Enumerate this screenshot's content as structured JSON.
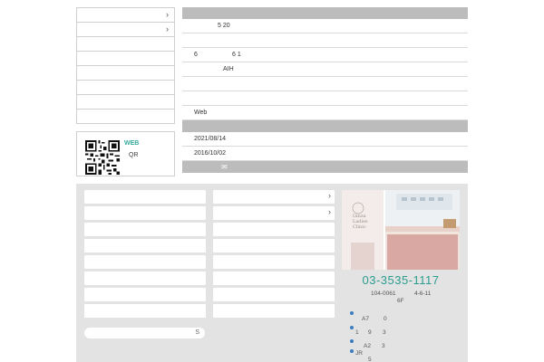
{
  "info_rows": [
    {
      "left": "",
      "right": "5 20"
    },
    {
      "left": "",
      "right": ""
    },
    {
      "left": "6",
      "right": "6 1"
    },
    {
      "left": "",
      "right": "AIH"
    },
    {
      "left": "",
      "right": ""
    },
    {
      "left": "Web",
      "right": ""
    }
  ],
  "news": [
    {
      "date": "2021/08/14"
    },
    {
      "date": "2016/10/02"
    }
  ],
  "qr": {
    "web_label": "WEB",
    "qr_label": "QR"
  },
  "clinic": {
    "logo_line1": "Ginza",
    "logo_line2": "Ladies",
    "logo_line3": "Clinic",
    "tel": "03-3535-1117",
    "postal": "104-0061",
    "address": "4-6-11",
    "floor": "6F"
  },
  "access": [
    {
      "line": "A7",
      "num": "0"
    },
    {
      "line": "1",
      "num": "9",
      "extra": "3"
    },
    {
      "line": "A2",
      "num": "3"
    },
    {
      "line": "JR",
      "num": "5"
    }
  ],
  "icons": {
    "chevron": "chevron-right-icon",
    "mail": "mail-icon",
    "search": "search-icon"
  },
  "colors": {
    "accent": "#2a9d8f",
    "header_bar": "#bcbcbc",
    "footer_bg": "#e3e3e3",
    "dot": "#3d7bbf"
  }
}
